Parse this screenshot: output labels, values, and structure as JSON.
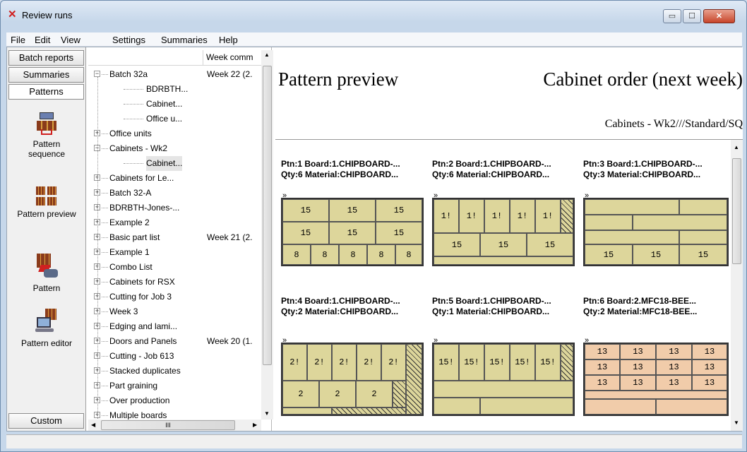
{
  "window": {
    "title": "Review runs",
    "minimize": "▭",
    "maximize": "☐",
    "close": "✕"
  },
  "menu": [
    "File",
    "Edit",
    "View",
    "Settings",
    "Summaries",
    "Help"
  ],
  "nav": {
    "tabs": [
      "Batch reports",
      "Summaries",
      "Patterns"
    ],
    "items": [
      "Pattern sequence",
      "Pattern preview",
      "Pattern",
      "Pattern editor"
    ],
    "bottom": "Custom"
  },
  "tree": {
    "column": "Week comm",
    "rows": [
      {
        "label": "Batch 32a",
        "week": "Week 22 (2.",
        "pm": "−"
      },
      {
        "label": "BDRBTH...",
        "week": "",
        "pm": ""
      },
      {
        "label": "Cabinet...",
        "week": "",
        "pm": ""
      },
      {
        "label": "Office u...",
        "week": "",
        "pm": ""
      },
      {
        "label": "Office units",
        "week": "",
        "pm": "+"
      },
      {
        "label": "Cabinets - Wk2",
        "week": "",
        "pm": "−"
      },
      {
        "label": "Cabinet...",
        "week": "",
        "pm": ""
      },
      {
        "label": "Cabinets for Le...",
        "week": "",
        "pm": "+"
      },
      {
        "label": "Batch 32-A",
        "week": "",
        "pm": "+"
      },
      {
        "label": "BDRBTH-Jones-...",
        "week": "",
        "pm": "+"
      },
      {
        "label": "Example 2",
        "week": "",
        "pm": "+"
      },
      {
        "label": "Basic part list",
        "week": "Week 21 (2.",
        "pm": "+"
      },
      {
        "label": "Example 1",
        "week": "",
        "pm": "+"
      },
      {
        "label": "Combo List",
        "week": "",
        "pm": "+"
      },
      {
        "label": "Cabinets for RSX",
        "week": "",
        "pm": "+"
      },
      {
        "label": "Cutting for Job 3",
        "week": "",
        "pm": "+"
      },
      {
        "label": "Week 3",
        "week": "",
        "pm": "+"
      },
      {
        "label": "Edging and lami...",
        "week": "",
        "pm": "+"
      },
      {
        "label": "Doors and Panels",
        "week": "Week 20 (1.",
        "pm": "+"
      },
      {
        "label": "Cutting - Job 613",
        "week": "",
        "pm": "+"
      },
      {
        "label": "Stacked duplicates",
        "week": "",
        "pm": "+"
      },
      {
        "label": "Part graining",
        "week": "",
        "pm": "+"
      },
      {
        "label": "Over production",
        "week": "",
        "pm": "+"
      },
      {
        "label": "Multiple boards",
        "week": "",
        "pm": "+"
      }
    ],
    "hscroll_label": "III"
  },
  "preview": {
    "title_left": "Pattern preview",
    "title_right": "Cabinet order (next week)",
    "subtitle": "Cabinets - Wk2///Standard/SQ",
    "grain_mark": "»",
    "patterns": [
      {
        "line1": "Ptn:1  Board:1.CHIPBOARD-...",
        "line2": "Qty:6  Material:CHIPBOARD..."
      },
      {
        "line1": "Ptn:2  Board:1.CHIPBOARD-...",
        "line2": "Qty:6  Material:CHIPBOARD..."
      },
      {
        "line1": "Ptn:3  Board:1.CHIPBOARD-...",
        "line2": "Qty:3  Material:CHIPBOARD..."
      },
      {
        "line1": "Ptn:4  Board:1.CHIPBOARD-...",
        "line2": "Qty:2  Material:CHIPBOARD..."
      },
      {
        "line1": "Ptn:5  Board:1.CHIPBOARD-...",
        "line2": "Qty:1  Material:CHIPBOARD..."
      },
      {
        "line1": "Ptn:6  Board:2.MFC18-BEE...",
        "line2": "Qty:2  Material:MFC18-BEE..."
      }
    ],
    "labels": {
      "p15": "15",
      "p8": "8",
      "p1b": "1!",
      "p2b": "2!",
      "p2": "2",
      "p15b": "15!",
      "p13": "13"
    }
  },
  "colors": {
    "board": "#ddd69b",
    "board_orange": "#f1ccaa",
    "accent": "#d02020"
  }
}
